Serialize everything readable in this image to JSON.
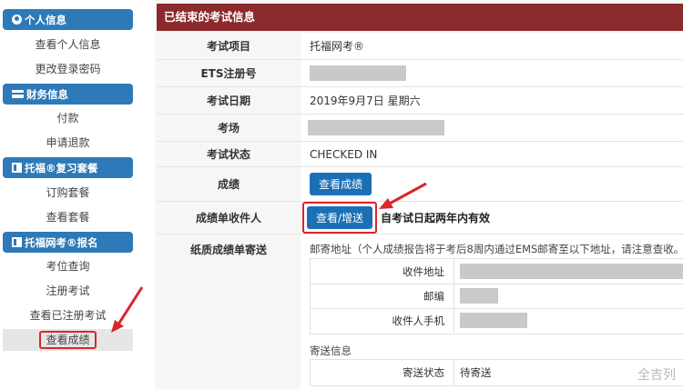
{
  "sidebar": {
    "personal": {
      "header": "个人信息",
      "links": [
        "查看个人信息",
        "更改登录密码"
      ]
    },
    "finance": {
      "header": "财务信息",
      "links": [
        "付款",
        "申请退款"
      ]
    },
    "review": {
      "header": "托福®复习套餐",
      "links": [
        "订购套餐",
        "查看套餐"
      ]
    },
    "register": {
      "header": "托福网考®报名",
      "links": [
        "考位查询",
        "注册考试",
        "查看已注册考试",
        "查看成绩"
      ]
    }
  },
  "panel": {
    "title": "已结束的考试信息",
    "rows": {
      "exam_item": {
        "label": "考试项目",
        "value": "托福网考®"
      },
      "ets_id": {
        "label": "ETS注册号"
      },
      "exam_date": {
        "label": "考试日期",
        "value": "2019年9月7日 星期六"
      },
      "venue": {
        "label": "考场"
      },
      "status": {
        "label": "考试状态",
        "value": "CHECKED IN"
      },
      "score": {
        "label": "成绩",
        "button": "查看成绩"
      },
      "recipients": {
        "label": "成绩单收件人",
        "button": "查看/增送",
        "note": "自考试日起两年内有效"
      },
      "mailing": {
        "label": "纸质成绩单寄送",
        "address_note": "邮寄地址（个人成绩报告将于考后8周内通过EMS邮寄至以下地址，请注意查收。",
        "fields": {
          "recipient": "收件地址",
          "postcode": "邮编",
          "phone": "收件人手机"
        },
        "shipping_label": "寄送信息",
        "shipping_status_label": "寄送状态",
        "shipping_status_value": "待寄送"
      }
    }
  },
  "watermark": "全吉列",
  "colors": {
    "nav_blue": "#2e7ab8",
    "panel_red": "#8b2a2c",
    "button_blue": "#1a6fb5",
    "highlight_red": "#d9262a"
  }
}
